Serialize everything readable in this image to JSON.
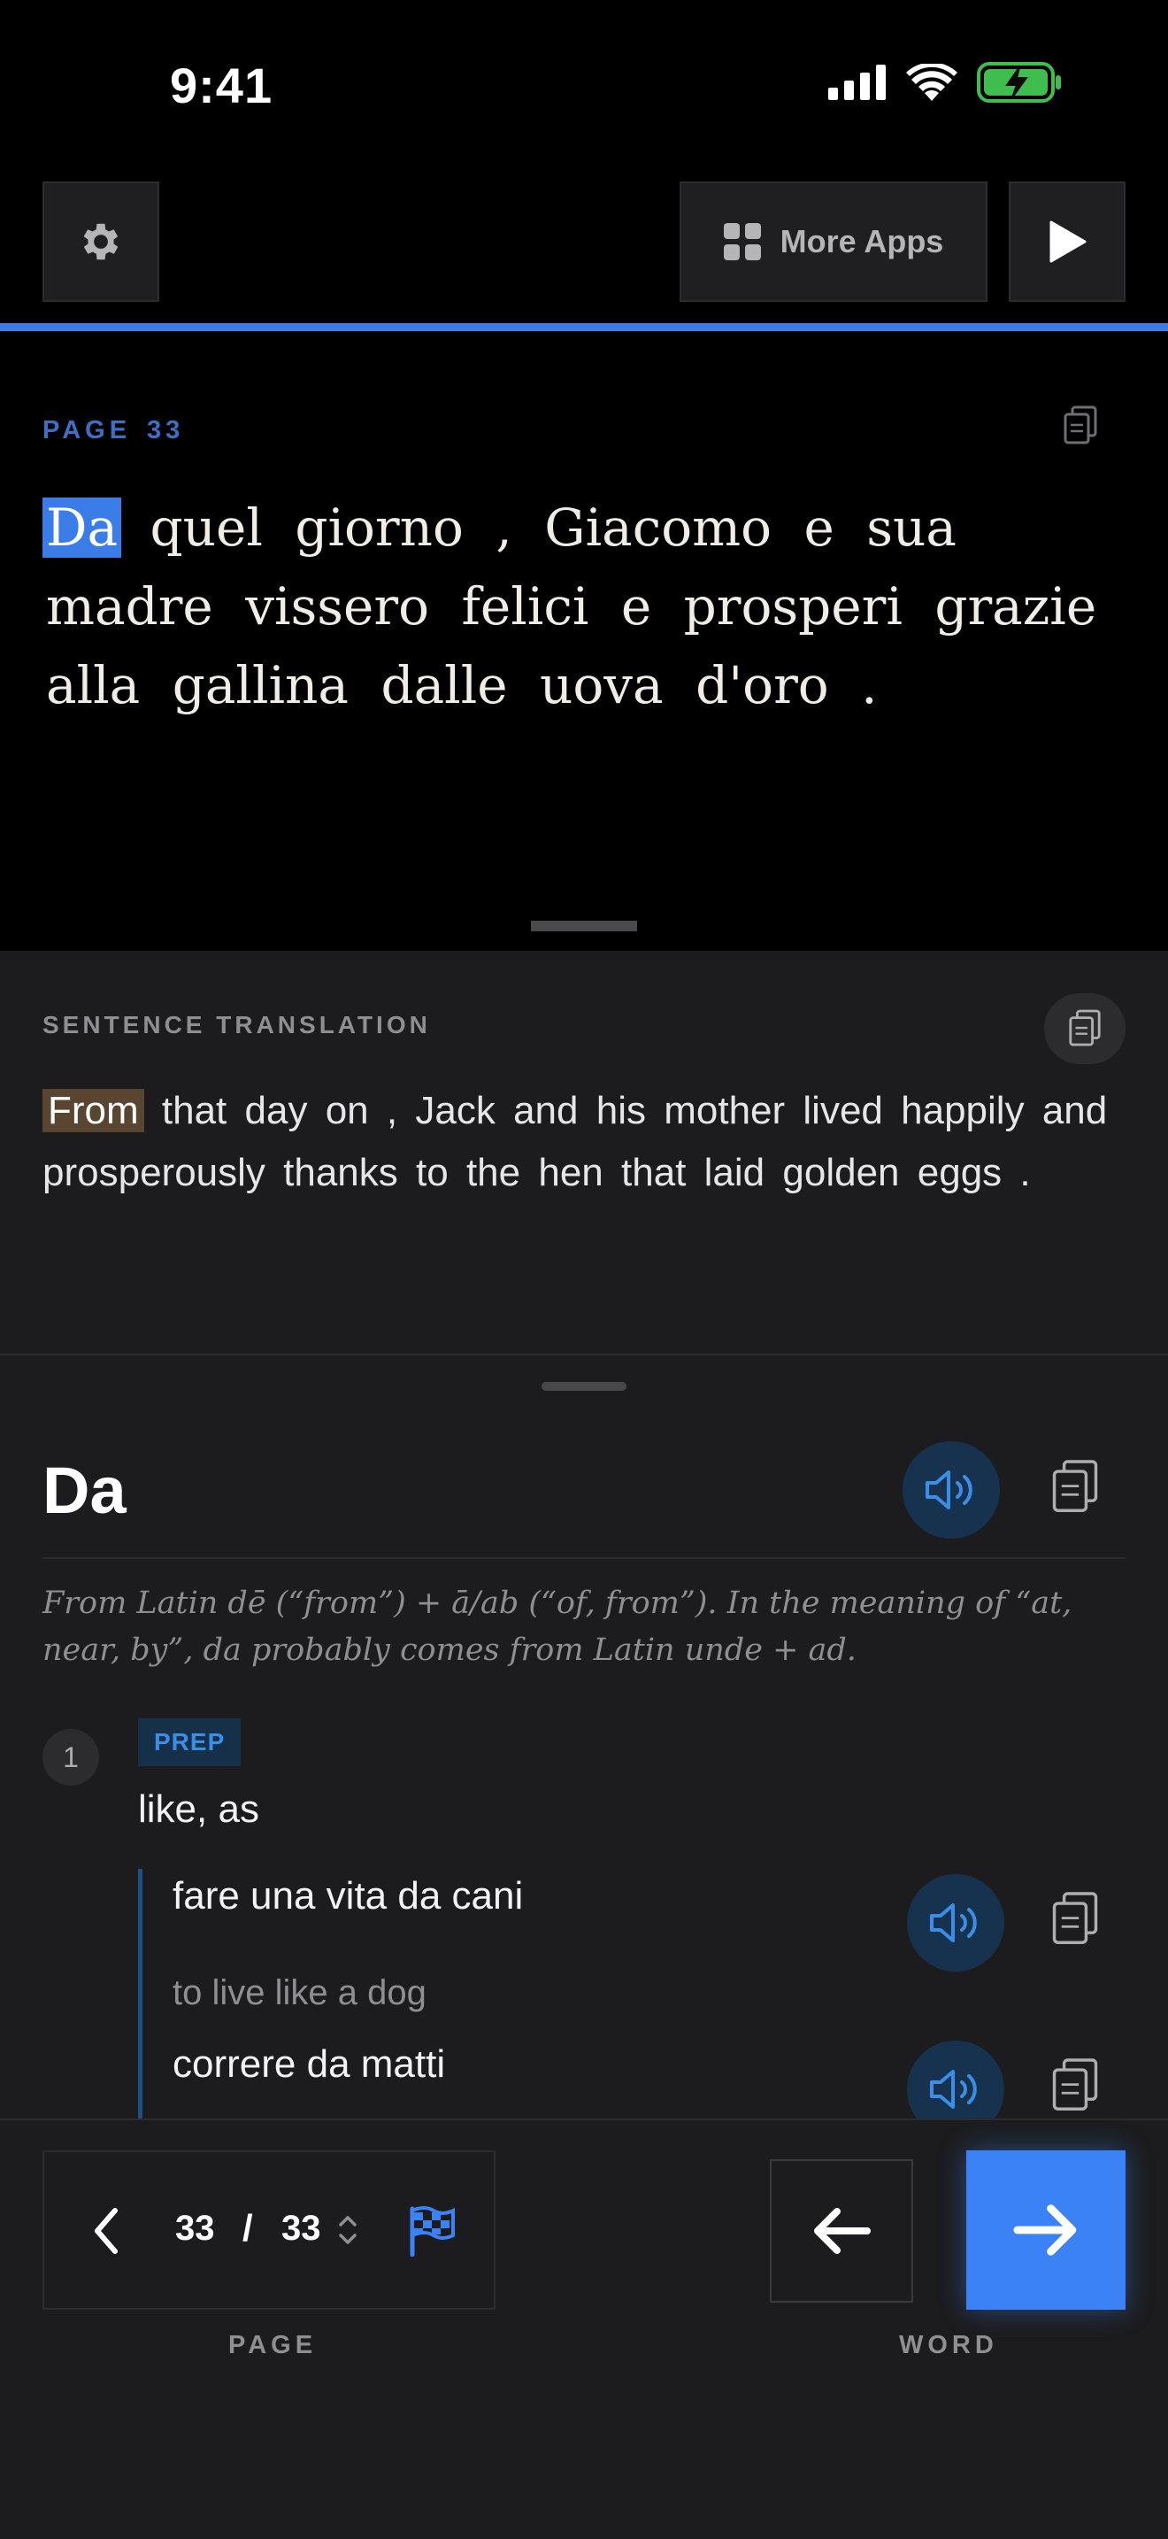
{
  "status_bar": {
    "time": "9:41"
  },
  "toolbar": {
    "settings_icon": "gear-icon",
    "more_apps_label": "More Apps",
    "more_apps_icon": "grid-icon",
    "play_icon": "play-icon",
    "accent_color": "#3b7de8"
  },
  "reader": {
    "page_label": "PAGE",
    "page_number": "33",
    "words": [
      "Da",
      "quel",
      "giorno",
      ",",
      "Giacomo",
      "e",
      "sua",
      "madre",
      "vissero",
      "felici",
      "e",
      "prosperi",
      "grazie",
      "alla",
      "gallina",
      "dalle",
      "uova",
      "d'oro",
      "."
    ],
    "highlighted_word_index": 0
  },
  "translation": {
    "label": "SENTENCE TRANSLATION",
    "words": [
      "From",
      "that",
      "day",
      "on",
      ",",
      "Jack",
      "and",
      "his",
      "mother",
      "lived",
      "happily",
      "and",
      "prosperously",
      "thanks",
      "to",
      "the",
      "hen",
      "that",
      "laid",
      "golden",
      "eggs",
      "."
    ],
    "highlighted_word_index": 0
  },
  "dictionary": {
    "headword": "Da",
    "etymology": "From Latin dē (“from”) + ā/ab (“of, from”). In the meaning of “at, near, by”, da probably comes from Latin unde + ad.",
    "senses": [
      {
        "number": "1",
        "pos": "PREP",
        "gloss": "like, as",
        "examples": [
          {
            "text": "fare una vita da cani",
            "translation": "to live like a dog"
          },
          {
            "text": "correre da matti",
            "translation": ""
          }
        ]
      }
    ]
  },
  "bottom_bar": {
    "current_page": "33",
    "separator": "/",
    "total_pages": "33",
    "page_label": "PAGE",
    "word_label": "WORD",
    "next_color": "#3b82f6"
  }
}
